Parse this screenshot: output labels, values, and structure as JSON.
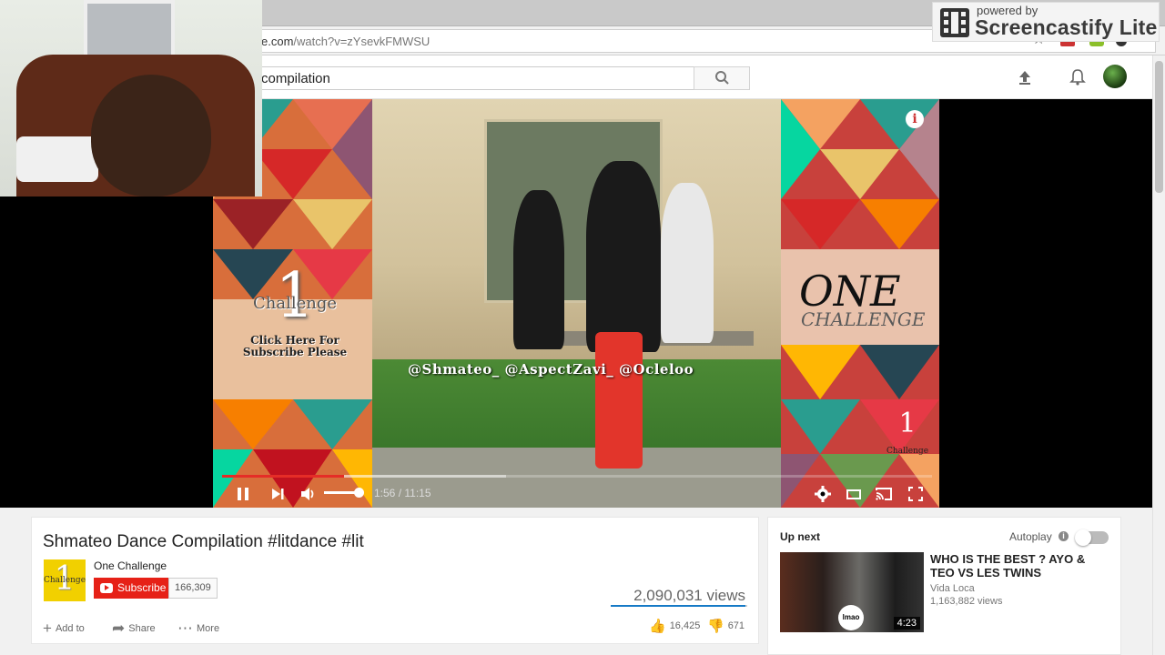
{
  "browser": {
    "url_prefix": "e.com",
    "url_path": "/watch?v=zYsevkFMWSU"
  },
  "screencastify": {
    "small": "powered by",
    "big": "Screencastify Lite"
  },
  "search": {
    "value": "compilation"
  },
  "video_overlay": {
    "handles": "@Shmateo_   @AspectZavi_   @Ocleloo",
    "left_number": "1",
    "left_challenge": "Challenge",
    "left_prompt": "Click Here For Subscribe Please",
    "right_one": "ONE",
    "right_challenge": "CHALLENGE",
    "corner_number": "1",
    "corner_label": "Challenge",
    "info": "i"
  },
  "player": {
    "time": "1:56 / 11:15",
    "progress": 0.172,
    "buffered": 0.4,
    "volume": 0.9
  },
  "video": {
    "title": "Shmateo Dance Compilation #litdance #lit",
    "channel": "One Challenge",
    "avatar_number": "1",
    "avatar_label": "Challenge",
    "subscribe_label": "Subscribe",
    "subscriber_count": "166,309",
    "views": "2,090,031 views",
    "likes": "16,425",
    "dislikes": "671",
    "actions": {
      "add_to": "Add to",
      "share": "Share",
      "more": "More"
    }
  },
  "sidebar": {
    "up_next": "Up next",
    "autoplay": "Autoplay",
    "autoplay_on": false,
    "related": [
      {
        "title": "WHO IS THE BEST ? AYO & TEO VS LES TWINS",
        "channel": "Vida Loca",
        "views": "1,163,882 views",
        "duration": "4:23",
        "badge": "lmao"
      }
    ]
  },
  "colors": {
    "youtube_red": "#e62117",
    "progress_red": "#e52d27",
    "link_blue": "#167ac6"
  }
}
